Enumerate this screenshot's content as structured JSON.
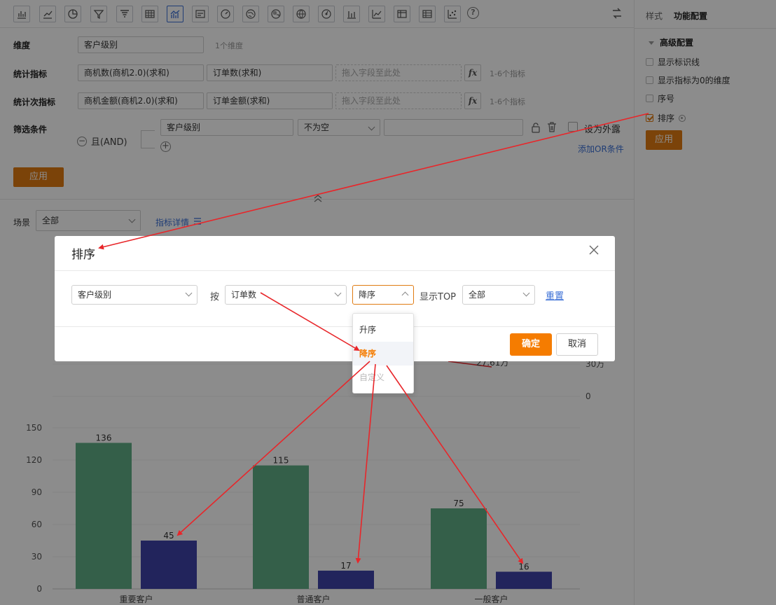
{
  "colors": {
    "accent": "#e07b12",
    "ok_button": "#f57c00",
    "link": "#3b6fd6",
    "bar_primary": "#5fae86",
    "bar_secondary": "#3f43a8",
    "annotation_arrow": "#e8262a"
  },
  "toolbar": {
    "icons": [
      "bar-chart-icon",
      "line-chart-icon",
      "pie-chart-icon",
      "funnel-icon",
      "funnel-stack-icon",
      "table-icon",
      "combo-chart-icon",
      "card-icon",
      "gauge-icon",
      "map-icon",
      "map-region-icon",
      "globe-icon",
      "dashboard-icon",
      "column-chart-icon",
      "trend-icon",
      "pivot-icon",
      "list-table-icon",
      "scatter-icon",
      "help-icon"
    ]
  },
  "right_panel": {
    "tabs": [
      "样式",
      "功能配置"
    ],
    "section": "高级配置",
    "options": [
      {
        "label": "显示标识线",
        "checked": false
      },
      {
        "label": "显示指标为0的维度",
        "checked": false
      },
      {
        "label": "序号",
        "checked": false
      },
      {
        "label": "排序",
        "checked": true
      }
    ],
    "apply": "应用"
  },
  "config": {
    "dimension": {
      "label": "维度",
      "value": "客户级别",
      "hint": "1个维度"
    },
    "metric": {
      "label": "统计指标",
      "values": [
        "商机数(商机2.0)(求和)",
        "订单数(求和)"
      ],
      "placeholder": "拖入字段至此处",
      "hint": "1-6个指标"
    },
    "sub_metric": {
      "label": "统计次指标",
      "values": [
        "商机金额(商机2.0)(求和)",
        "订单金额(求和)"
      ],
      "placeholder": "拖入字段至此处",
      "hint": "1-6个指标"
    },
    "filter": {
      "label": "筛选条件",
      "logic": "且(AND)",
      "field": "客户级别",
      "operator": "不为空",
      "value": "",
      "expose": "设为外露",
      "add_or": "添加OR条件"
    },
    "apply": "应用"
  },
  "scene": {
    "label": "场景",
    "value": "全部",
    "details_link": "指标详情"
  },
  "chart_data": {
    "type": "bar",
    "categories": [
      "重要客户",
      "普通客户",
      "一般客户"
    ],
    "series": [
      {
        "values": [
          136,
          115,
          75
        ]
      },
      {
        "values": [
          45,
          17,
          16
        ]
      }
    ],
    "ylim": [
      0,
      150
    ],
    "yticks": [
      "0",
      "30",
      "60",
      "90",
      "120",
      "150"
    ],
    "secondary_axis_ticks": [
      "30万",
      "0"
    ],
    "line_label": "27.61万"
  },
  "modal": {
    "title": "排序",
    "field": "客户级别",
    "by_label": "按",
    "by_value": "订单数",
    "order_value": "降序",
    "top_label": "显示TOP",
    "top_value": "全部",
    "reset": "重置",
    "ok": "确定",
    "cancel": "取消",
    "dropdown": [
      {
        "label": "升序",
        "state": "normal"
      },
      {
        "label": "降序",
        "state": "selected"
      },
      {
        "label": "自定义",
        "state": "disabled"
      }
    ]
  }
}
